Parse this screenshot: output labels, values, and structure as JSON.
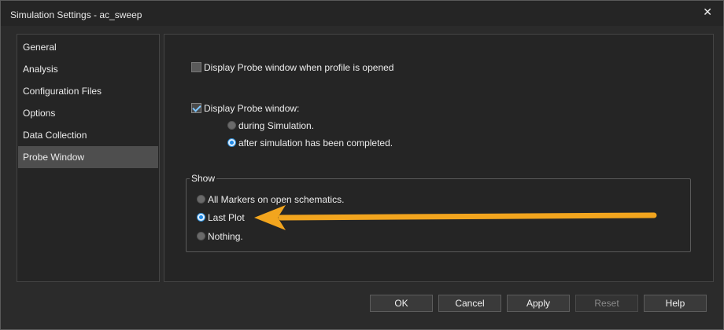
{
  "window": {
    "title": "Simulation Settings - ac_sweep",
    "close_glyph": "✕"
  },
  "sidebar": {
    "items": [
      {
        "label": "General",
        "active": false
      },
      {
        "label": "Analysis",
        "active": false
      },
      {
        "label": "Configuration Files",
        "active": false
      },
      {
        "label": "Options",
        "active": false
      },
      {
        "label": "Data Collection",
        "active": false
      },
      {
        "label": "Probe Window",
        "active": true
      }
    ]
  },
  "probe": {
    "open_on_profile_label": "Display Probe window when profile is opened",
    "open_on_profile_checked": false,
    "display_probe_label": "Display Probe window:",
    "display_probe_checked": true,
    "timing_options": [
      {
        "label": "during Simulation.",
        "selected": false
      },
      {
        "label": "after simulation has been completed.",
        "selected": true
      }
    ]
  },
  "show": {
    "legend": "Show",
    "options": [
      {
        "label": "All Markers on open schematics.",
        "selected": false
      },
      {
        "label": "Last Plot",
        "selected": true
      },
      {
        "label": "Nothing.",
        "selected": false
      }
    ]
  },
  "annotation": {
    "arrow_color": "#f2a51e",
    "icon": "arrow-left"
  },
  "buttons": {
    "ok": "OK",
    "cancel": "Cancel",
    "apply": "Apply",
    "reset": "Reset",
    "help": "Help"
  },
  "colors": {
    "accent": "#1e88e5",
    "check": "#7ec7ff"
  }
}
